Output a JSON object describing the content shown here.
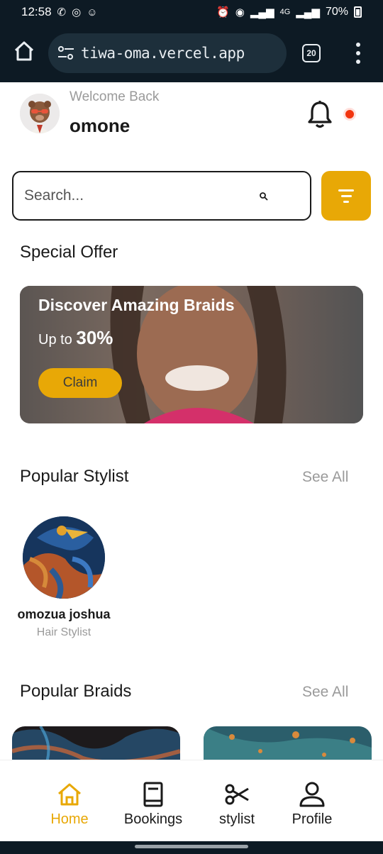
{
  "status_bar": {
    "time": "12:58",
    "network": "4G",
    "battery": "70%"
  },
  "browser": {
    "url": "tiwa-oma.vercel.app",
    "tab_count": "20"
  },
  "header": {
    "welcome": "Welcome Back",
    "username": "omone"
  },
  "search": {
    "placeholder": "Search..."
  },
  "special_offer": {
    "title": "Special Offer",
    "card_title": "Discover Amazing Braids",
    "prefix": "Up to",
    "discount": "30%",
    "claim_label": "Claim"
  },
  "popular_stylist": {
    "title": "Popular Stylist",
    "see_all": "See All",
    "items": [
      {
        "name": "omozua joshua",
        "role": "Hair Stylist"
      }
    ]
  },
  "popular_braids": {
    "title": "Popular Braids",
    "see_all": "See All"
  },
  "nav": {
    "items": [
      {
        "label": "Home",
        "icon": "home-icon",
        "active": true
      },
      {
        "label": "Bookings",
        "icon": "book-icon",
        "active": false
      },
      {
        "label": "stylist",
        "icon": "scissors-icon",
        "active": false
      },
      {
        "label": "Profile",
        "icon": "person-icon",
        "active": false
      }
    ]
  },
  "colors": {
    "accent": "#e8a806",
    "dark_bar": "#0d1a24",
    "notification": "#f2350f"
  }
}
